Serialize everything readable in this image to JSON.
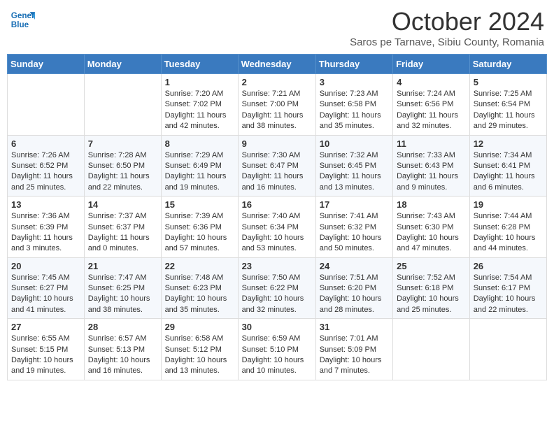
{
  "logo": {
    "line1": "General",
    "line2": "Blue"
  },
  "title": "October 2024",
  "subtitle": "Saros pe Tarnave, Sibiu County, Romania",
  "days_of_week": [
    "Sunday",
    "Monday",
    "Tuesday",
    "Wednesday",
    "Thursday",
    "Friday",
    "Saturday"
  ],
  "weeks": [
    [
      {
        "day": "",
        "info": ""
      },
      {
        "day": "",
        "info": ""
      },
      {
        "day": "1",
        "info": "Sunrise: 7:20 AM\nSunset: 7:02 PM\nDaylight: 11 hours and 42 minutes."
      },
      {
        "day": "2",
        "info": "Sunrise: 7:21 AM\nSunset: 7:00 PM\nDaylight: 11 hours and 38 minutes."
      },
      {
        "day": "3",
        "info": "Sunrise: 7:23 AM\nSunset: 6:58 PM\nDaylight: 11 hours and 35 minutes."
      },
      {
        "day": "4",
        "info": "Sunrise: 7:24 AM\nSunset: 6:56 PM\nDaylight: 11 hours and 32 minutes."
      },
      {
        "day": "5",
        "info": "Sunrise: 7:25 AM\nSunset: 6:54 PM\nDaylight: 11 hours and 29 minutes."
      }
    ],
    [
      {
        "day": "6",
        "info": "Sunrise: 7:26 AM\nSunset: 6:52 PM\nDaylight: 11 hours and 25 minutes."
      },
      {
        "day": "7",
        "info": "Sunrise: 7:28 AM\nSunset: 6:50 PM\nDaylight: 11 hours and 22 minutes."
      },
      {
        "day": "8",
        "info": "Sunrise: 7:29 AM\nSunset: 6:49 PM\nDaylight: 11 hours and 19 minutes."
      },
      {
        "day": "9",
        "info": "Sunrise: 7:30 AM\nSunset: 6:47 PM\nDaylight: 11 hours and 16 minutes."
      },
      {
        "day": "10",
        "info": "Sunrise: 7:32 AM\nSunset: 6:45 PM\nDaylight: 11 hours and 13 minutes."
      },
      {
        "day": "11",
        "info": "Sunrise: 7:33 AM\nSunset: 6:43 PM\nDaylight: 11 hours and 9 minutes."
      },
      {
        "day": "12",
        "info": "Sunrise: 7:34 AM\nSunset: 6:41 PM\nDaylight: 11 hours and 6 minutes."
      }
    ],
    [
      {
        "day": "13",
        "info": "Sunrise: 7:36 AM\nSunset: 6:39 PM\nDaylight: 11 hours and 3 minutes."
      },
      {
        "day": "14",
        "info": "Sunrise: 7:37 AM\nSunset: 6:37 PM\nDaylight: 11 hours and 0 minutes."
      },
      {
        "day": "15",
        "info": "Sunrise: 7:39 AM\nSunset: 6:36 PM\nDaylight: 10 hours and 57 minutes."
      },
      {
        "day": "16",
        "info": "Sunrise: 7:40 AM\nSunset: 6:34 PM\nDaylight: 10 hours and 53 minutes."
      },
      {
        "day": "17",
        "info": "Sunrise: 7:41 AM\nSunset: 6:32 PM\nDaylight: 10 hours and 50 minutes."
      },
      {
        "day": "18",
        "info": "Sunrise: 7:43 AM\nSunset: 6:30 PM\nDaylight: 10 hours and 47 minutes."
      },
      {
        "day": "19",
        "info": "Sunrise: 7:44 AM\nSunset: 6:28 PM\nDaylight: 10 hours and 44 minutes."
      }
    ],
    [
      {
        "day": "20",
        "info": "Sunrise: 7:45 AM\nSunset: 6:27 PM\nDaylight: 10 hours and 41 minutes."
      },
      {
        "day": "21",
        "info": "Sunrise: 7:47 AM\nSunset: 6:25 PM\nDaylight: 10 hours and 38 minutes."
      },
      {
        "day": "22",
        "info": "Sunrise: 7:48 AM\nSunset: 6:23 PM\nDaylight: 10 hours and 35 minutes."
      },
      {
        "day": "23",
        "info": "Sunrise: 7:50 AM\nSunset: 6:22 PM\nDaylight: 10 hours and 32 minutes."
      },
      {
        "day": "24",
        "info": "Sunrise: 7:51 AM\nSunset: 6:20 PM\nDaylight: 10 hours and 28 minutes."
      },
      {
        "day": "25",
        "info": "Sunrise: 7:52 AM\nSunset: 6:18 PM\nDaylight: 10 hours and 25 minutes."
      },
      {
        "day": "26",
        "info": "Sunrise: 7:54 AM\nSunset: 6:17 PM\nDaylight: 10 hours and 22 minutes."
      }
    ],
    [
      {
        "day": "27",
        "info": "Sunrise: 6:55 AM\nSunset: 5:15 PM\nDaylight: 10 hours and 19 minutes."
      },
      {
        "day": "28",
        "info": "Sunrise: 6:57 AM\nSunset: 5:13 PM\nDaylight: 10 hours and 16 minutes."
      },
      {
        "day": "29",
        "info": "Sunrise: 6:58 AM\nSunset: 5:12 PM\nDaylight: 10 hours and 13 minutes."
      },
      {
        "day": "30",
        "info": "Sunrise: 6:59 AM\nSunset: 5:10 PM\nDaylight: 10 hours and 10 minutes."
      },
      {
        "day": "31",
        "info": "Sunrise: 7:01 AM\nSunset: 5:09 PM\nDaylight: 10 hours and 7 minutes."
      },
      {
        "day": "",
        "info": ""
      },
      {
        "day": "",
        "info": ""
      }
    ]
  ]
}
